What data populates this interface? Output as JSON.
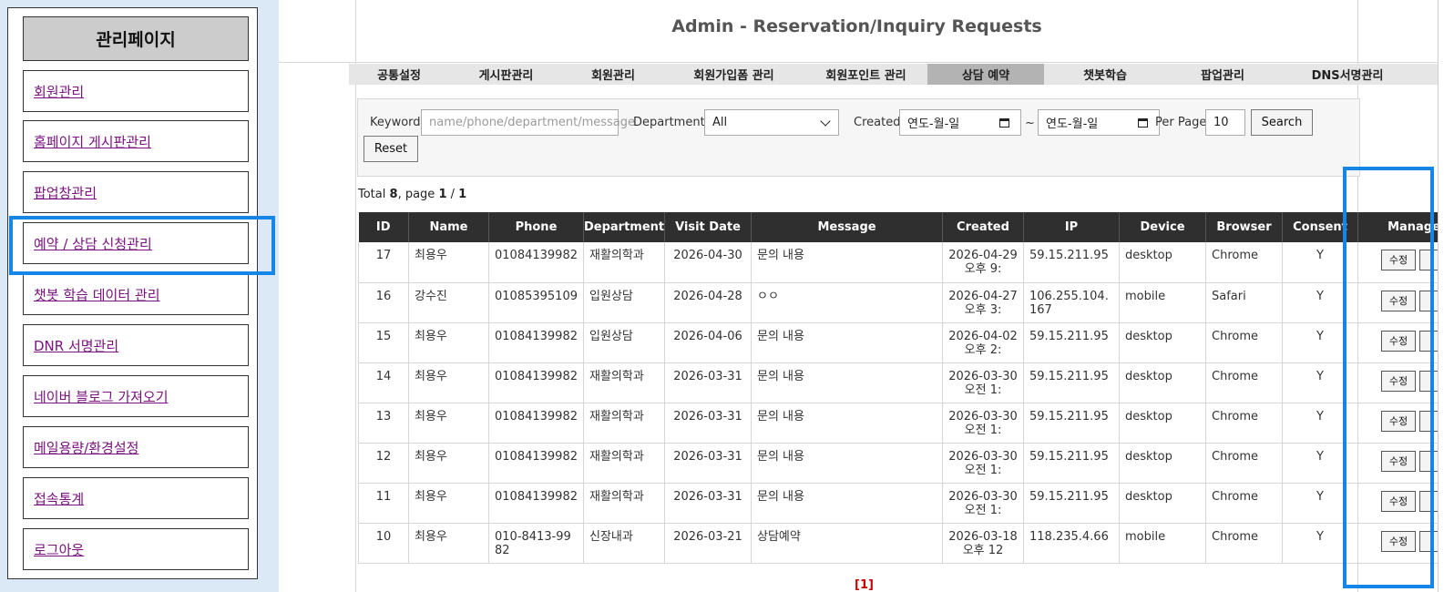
{
  "sidebar": {
    "title": "관리페이지",
    "items": [
      {
        "label": "회원관리"
      },
      {
        "label": "홈페이지 게시판관리"
      },
      {
        "label": "팝업창관리"
      },
      {
        "label": "예약 / 상담 신청관리"
      },
      {
        "label": "챗봇 학습 데이터 관리"
      },
      {
        "label": "DNR 서명관리"
      },
      {
        "label": "네이버 블로그 가져오기"
      },
      {
        "label": "메일용량/환경설정"
      },
      {
        "label": "접속통계"
      },
      {
        "label": "로그아웃"
      }
    ]
  },
  "page": {
    "title": "Admin - Reservation/Inquiry Requests"
  },
  "nav": {
    "tabs": [
      {
        "label": "공통설정",
        "active": false
      },
      {
        "label": "게시판관리",
        "active": false
      },
      {
        "label": "회원관리",
        "active": false
      },
      {
        "label": "회원가입폼 관리",
        "active": false
      },
      {
        "label": "회원포인트 관리",
        "active": false
      },
      {
        "label": "상담 예약",
        "active": true
      },
      {
        "label": "챗봇학습",
        "active": false
      },
      {
        "label": "팝업관리",
        "active": false
      },
      {
        "label": "DNS서명관리",
        "active": false
      }
    ]
  },
  "filter": {
    "keyword_label": "Keyword",
    "keyword_placeholder": "name/phone/department/message",
    "department_label": "Department",
    "department_value": "All",
    "created_label": "Created",
    "date_from_placeholder": "연도-월-일",
    "date_separator": "~",
    "date_to_placeholder": "연도-월-일",
    "per_page_label": "Per Page",
    "per_page_value": "10",
    "search_button": "Search",
    "reset_button": "Reset"
  },
  "summary": {
    "total_label": "Total",
    "total": "8",
    "page_label": ", page",
    "page": "1",
    "separator": "/",
    "pages": "1"
  },
  "table": {
    "columns": [
      "ID",
      "Name",
      "Phone",
      "Department",
      "Visit Date",
      "Message",
      "Created",
      "IP",
      "Device",
      "Browser",
      "Consent",
      "Manage"
    ],
    "edit_label": "수정",
    "rows": [
      {
        "id": "17",
        "name": "최용우",
        "phone": "01084139982",
        "department": "재활의학과",
        "visit_date": "2026-04-30",
        "message": "문의 내용",
        "created": "2026-04-29 오후 9:",
        "ip": "59.15.211.95",
        "device": "desktop",
        "browser": "Chrome",
        "consent": "Y"
      },
      {
        "id": "16",
        "name": "강수진",
        "phone": "01085395109",
        "department": "입원상담",
        "visit_date": "2026-04-28",
        "message": "ㅇㅇ",
        "created": "2026-04-27 오후 3:",
        "ip": "106.255.104.167",
        "device": "mobile",
        "browser": "Safari",
        "consent": "Y"
      },
      {
        "id": "15",
        "name": "최용우",
        "phone": "01084139982",
        "department": "입원상담",
        "visit_date": "2026-04-06",
        "message": "문의 내용",
        "created": "2026-04-02 오후 2:",
        "ip": "59.15.211.95",
        "device": "desktop",
        "browser": "Chrome",
        "consent": "Y"
      },
      {
        "id": "14",
        "name": "최용우",
        "phone": "01084139982",
        "department": "재활의학과",
        "visit_date": "2026-03-31",
        "message": "문의 내용",
        "created": "2026-03-30 오전 1:",
        "ip": "59.15.211.95",
        "device": "desktop",
        "browser": "Chrome",
        "consent": "Y"
      },
      {
        "id": "13",
        "name": "최용우",
        "phone": "01084139982",
        "department": "재활의학과",
        "visit_date": "2026-03-31",
        "message": "문의 내용",
        "created": "2026-03-30 오전 1:",
        "ip": "59.15.211.95",
        "device": "desktop",
        "browser": "Chrome",
        "consent": "Y"
      },
      {
        "id": "12",
        "name": "최용우",
        "phone": "01084139982",
        "department": "재활의학과",
        "visit_date": "2026-03-31",
        "message": "문의 내용",
        "created": "2026-03-30 오전 1:",
        "ip": "59.15.211.95",
        "device": "desktop",
        "browser": "Chrome",
        "consent": "Y"
      },
      {
        "id": "11",
        "name": "최용우",
        "phone": "01084139982",
        "department": "재활의학과",
        "visit_date": "2026-03-31",
        "message": "문의 내용",
        "created": "2026-03-30 오전 1:",
        "ip": "59.15.211.95",
        "device": "desktop",
        "browser": "Chrome",
        "consent": "Y"
      },
      {
        "id": "10",
        "name": "최용우",
        "phone": "010-8413-9982",
        "department": "신장내과",
        "visit_date": "2026-03-21",
        "message": "상담예약",
        "created": "2026-03-18 오후 12",
        "ip": "118.235.4.66",
        "device": "mobile",
        "browser": "Chrome",
        "consent": "Y"
      }
    ]
  },
  "pagination": {
    "current": "[1]"
  },
  "colors": {
    "highlight": "#1685e8",
    "link": "#7b1280",
    "table_header": "#2f2f2f",
    "pagination": "#cc0000"
  }
}
